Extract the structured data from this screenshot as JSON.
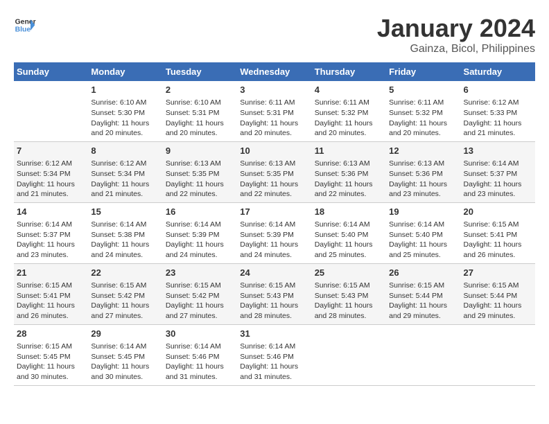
{
  "header": {
    "logo_line1": "General",
    "logo_line2": "Blue",
    "title": "January 2024",
    "subtitle": "Gainza, Bicol, Philippines"
  },
  "columns": [
    "Sunday",
    "Monday",
    "Tuesday",
    "Wednesday",
    "Thursday",
    "Friday",
    "Saturday"
  ],
  "weeks": [
    {
      "days": [
        {
          "num": "",
          "info": ""
        },
        {
          "num": "1",
          "info": "Sunrise: 6:10 AM\nSunset: 5:30 PM\nDaylight: 11 hours\nand 20 minutes."
        },
        {
          "num": "2",
          "info": "Sunrise: 6:10 AM\nSunset: 5:31 PM\nDaylight: 11 hours\nand 20 minutes."
        },
        {
          "num": "3",
          "info": "Sunrise: 6:11 AM\nSunset: 5:31 PM\nDaylight: 11 hours\nand 20 minutes."
        },
        {
          "num": "4",
          "info": "Sunrise: 6:11 AM\nSunset: 5:32 PM\nDaylight: 11 hours\nand 20 minutes."
        },
        {
          "num": "5",
          "info": "Sunrise: 6:11 AM\nSunset: 5:32 PM\nDaylight: 11 hours\nand 20 minutes."
        },
        {
          "num": "6",
          "info": "Sunrise: 6:12 AM\nSunset: 5:33 PM\nDaylight: 11 hours\nand 21 minutes."
        }
      ]
    },
    {
      "days": [
        {
          "num": "7",
          "info": "Sunrise: 6:12 AM\nSunset: 5:34 PM\nDaylight: 11 hours\nand 21 minutes."
        },
        {
          "num": "8",
          "info": "Sunrise: 6:12 AM\nSunset: 5:34 PM\nDaylight: 11 hours\nand 21 minutes."
        },
        {
          "num": "9",
          "info": "Sunrise: 6:13 AM\nSunset: 5:35 PM\nDaylight: 11 hours\nand 22 minutes."
        },
        {
          "num": "10",
          "info": "Sunrise: 6:13 AM\nSunset: 5:35 PM\nDaylight: 11 hours\nand 22 minutes."
        },
        {
          "num": "11",
          "info": "Sunrise: 6:13 AM\nSunset: 5:36 PM\nDaylight: 11 hours\nand 22 minutes."
        },
        {
          "num": "12",
          "info": "Sunrise: 6:13 AM\nSunset: 5:36 PM\nDaylight: 11 hours\nand 23 minutes."
        },
        {
          "num": "13",
          "info": "Sunrise: 6:14 AM\nSunset: 5:37 PM\nDaylight: 11 hours\nand 23 minutes."
        }
      ]
    },
    {
      "days": [
        {
          "num": "14",
          "info": "Sunrise: 6:14 AM\nSunset: 5:37 PM\nDaylight: 11 hours\nand 23 minutes."
        },
        {
          "num": "15",
          "info": "Sunrise: 6:14 AM\nSunset: 5:38 PM\nDaylight: 11 hours\nand 24 minutes."
        },
        {
          "num": "16",
          "info": "Sunrise: 6:14 AM\nSunset: 5:39 PM\nDaylight: 11 hours\nand 24 minutes."
        },
        {
          "num": "17",
          "info": "Sunrise: 6:14 AM\nSunset: 5:39 PM\nDaylight: 11 hours\nand 24 minutes."
        },
        {
          "num": "18",
          "info": "Sunrise: 6:14 AM\nSunset: 5:40 PM\nDaylight: 11 hours\nand 25 minutes."
        },
        {
          "num": "19",
          "info": "Sunrise: 6:14 AM\nSunset: 5:40 PM\nDaylight: 11 hours\nand 25 minutes."
        },
        {
          "num": "20",
          "info": "Sunrise: 6:15 AM\nSunset: 5:41 PM\nDaylight: 11 hours\nand 26 minutes."
        }
      ]
    },
    {
      "days": [
        {
          "num": "21",
          "info": "Sunrise: 6:15 AM\nSunset: 5:41 PM\nDaylight: 11 hours\nand 26 minutes."
        },
        {
          "num": "22",
          "info": "Sunrise: 6:15 AM\nSunset: 5:42 PM\nDaylight: 11 hours\nand 27 minutes."
        },
        {
          "num": "23",
          "info": "Sunrise: 6:15 AM\nSunset: 5:42 PM\nDaylight: 11 hours\nand 27 minutes."
        },
        {
          "num": "24",
          "info": "Sunrise: 6:15 AM\nSunset: 5:43 PM\nDaylight: 11 hours\nand 28 minutes."
        },
        {
          "num": "25",
          "info": "Sunrise: 6:15 AM\nSunset: 5:43 PM\nDaylight: 11 hours\nand 28 minutes."
        },
        {
          "num": "26",
          "info": "Sunrise: 6:15 AM\nSunset: 5:44 PM\nDaylight: 11 hours\nand 29 minutes."
        },
        {
          "num": "27",
          "info": "Sunrise: 6:15 AM\nSunset: 5:44 PM\nDaylight: 11 hours\nand 29 minutes."
        }
      ]
    },
    {
      "days": [
        {
          "num": "28",
          "info": "Sunrise: 6:15 AM\nSunset: 5:45 PM\nDaylight: 11 hours\nand 30 minutes."
        },
        {
          "num": "29",
          "info": "Sunrise: 6:14 AM\nSunset: 5:45 PM\nDaylight: 11 hours\nand 30 minutes."
        },
        {
          "num": "30",
          "info": "Sunrise: 6:14 AM\nSunset: 5:46 PM\nDaylight: 11 hours\nand 31 minutes."
        },
        {
          "num": "31",
          "info": "Sunrise: 6:14 AM\nSunset: 5:46 PM\nDaylight: 11 hours\nand 31 minutes."
        },
        {
          "num": "",
          "info": ""
        },
        {
          "num": "",
          "info": ""
        },
        {
          "num": "",
          "info": ""
        }
      ]
    }
  ]
}
